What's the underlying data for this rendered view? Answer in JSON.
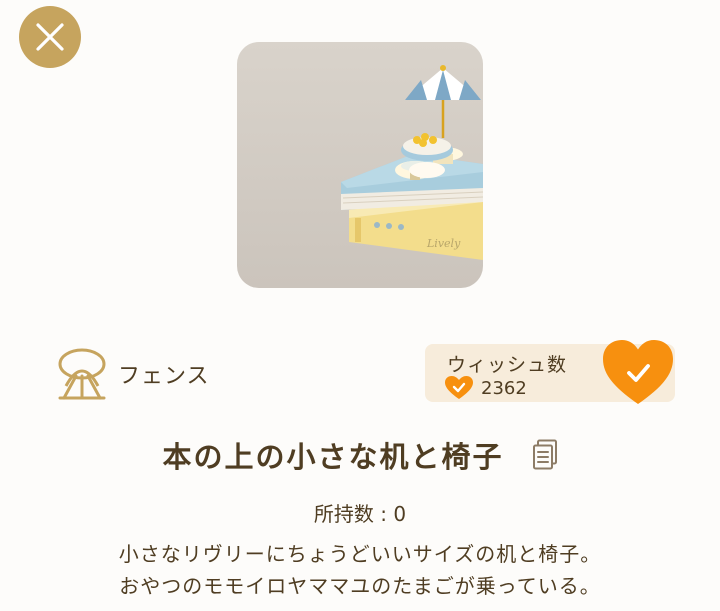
{
  "item": {
    "category": "フェンス",
    "title": "本の上の小さな机と椅子",
    "owned": "所持数 : 0",
    "description": [
      "小さなリヴリーにちょうどいいサイズの机と椅子。",
      "おやつのモモイロヤママユのたまごが乗っている。"
    ]
  },
  "wishlist": {
    "label": "ウィッシュ数",
    "count": "2362"
  },
  "colors": {
    "gold": "#c6a45e",
    "orange": "#f7900f",
    "text": "#4f3d22",
    "wish_bg": "#f7ecdb"
  },
  "icons": {
    "close": "close-icon",
    "category": "fence-category-icon",
    "heart_check": "heart-check-icon",
    "document": "document-icon"
  }
}
